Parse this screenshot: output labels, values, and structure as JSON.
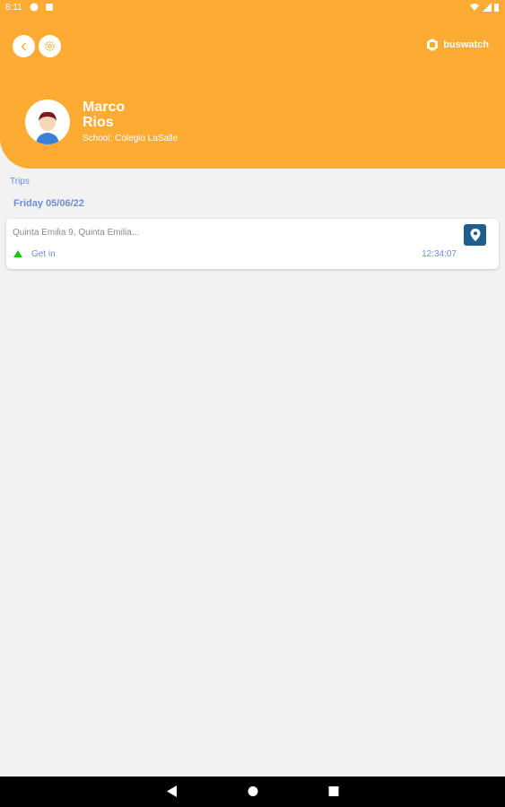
{
  "status_bar": {
    "time": "8:11"
  },
  "header": {
    "brand": "buswatch",
    "student": {
      "first_name": "Marco",
      "last_name": "Rios",
      "school": "School: Colegio LaSalle"
    },
    "color": "#fdab33"
  },
  "trips": {
    "section_label": "Trips",
    "date_label": "Friday 05/06/22",
    "items": [
      {
        "address": "Quinta Emilia 9, Quinta Emilia...",
        "status": "Get in",
        "time": "12:34:07",
        "status_icon": "arrow-up-icon"
      }
    ]
  },
  "icons": [
    "back-icon",
    "settings-icon",
    "buswatch-logo-icon",
    "map-pin-icon",
    "nav-back-icon",
    "nav-home-icon",
    "nav-recents-icon"
  ],
  "colors": {
    "accent": "#fdab33",
    "link": "#6b8fd6",
    "map_button": "#1f5d8f",
    "get_in": "#20c020"
  }
}
